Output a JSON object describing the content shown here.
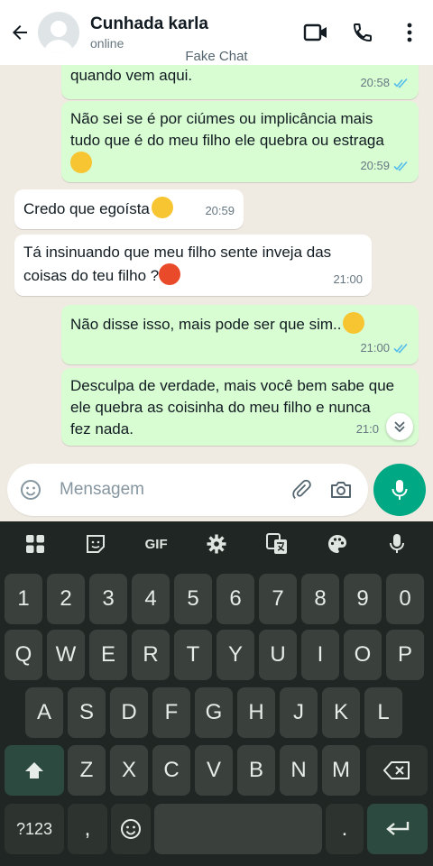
{
  "header": {
    "contact_name": "Cunhada karla",
    "status": "online",
    "icons": [
      "back-arrow-icon",
      "video-call-icon",
      "phone-call-icon",
      "more-options-icon"
    ]
  },
  "watermark": "Fake Chat",
  "messages": [
    {
      "dir": "out",
      "text": "quando vem aqui.",
      "time": "20:58",
      "read": true
    },
    {
      "dir": "out",
      "text": "Não sei se é por ciúmes ou implicância mais tudo que é do meu filho ele quebra ou estraga",
      "emoji": "woman-facepalming-emoji",
      "time": "20:59",
      "read": true
    },
    {
      "dir": "in",
      "text": "Credo que egoísta",
      "emoji": "face-with-raised-eyebrow-emoji",
      "time": "20:59"
    },
    {
      "dir": "in",
      "text": "Tá insinuando que meu filho sente  inveja das coisas do teu filho ?",
      "emoji": "angry-face-emoji",
      "time": "21:00"
    },
    {
      "dir": "out",
      "text": "Não disse isso, mais pode ser que sim..",
      "emoji": "slightly-smiling-face-emoji",
      "time": "21:00",
      "read": true
    },
    {
      "dir": "out",
      "text": "Desculpa de verdade, mais você bem sabe que ele quebra as coisinha do meu filho e nunca fez nada.",
      "time": "21:0",
      "read": true
    }
  ],
  "composer": {
    "placeholder": "Mensagem",
    "icons": [
      "emoji-icon",
      "attach-icon",
      "camera-icon",
      "microphone-icon"
    ]
  },
  "keyboard": {
    "toolbar": [
      "apps-grid-icon",
      "sticker-icon",
      "GIF",
      "settings-icon",
      "translate-icon",
      "theme-palette-icon",
      "voice-input-icon"
    ],
    "gif_label": "GIF",
    "row_numbers": [
      "1",
      "2",
      "3",
      "4",
      "5",
      "6",
      "7",
      "8",
      "9",
      "0"
    ],
    "row_top": [
      "Q",
      "W",
      "E",
      "R",
      "T",
      "Y",
      "U",
      "I",
      "O",
      "P"
    ],
    "row_home": [
      "A",
      "S",
      "D",
      "F",
      "G",
      "H",
      "J",
      "K",
      "L"
    ],
    "row_bottom": [
      "Z",
      "X",
      "C",
      "V",
      "B",
      "N",
      "M"
    ],
    "symbols_label": "?123",
    "comma": ",",
    "period": ".",
    "icons": [
      "shift-icon",
      "backspace-icon",
      "emoji-key-icon",
      "enter-icon"
    ]
  },
  "colors": {
    "chat_bg": "#efeae2",
    "outgoing_bubble": "#d9fdd3",
    "incoming_bubble": "#ffffff",
    "read_tick": "#53bdeb",
    "accent": "#00a884",
    "keyboard_bg": "#1f2623",
    "key_bg": "#3a413d"
  }
}
